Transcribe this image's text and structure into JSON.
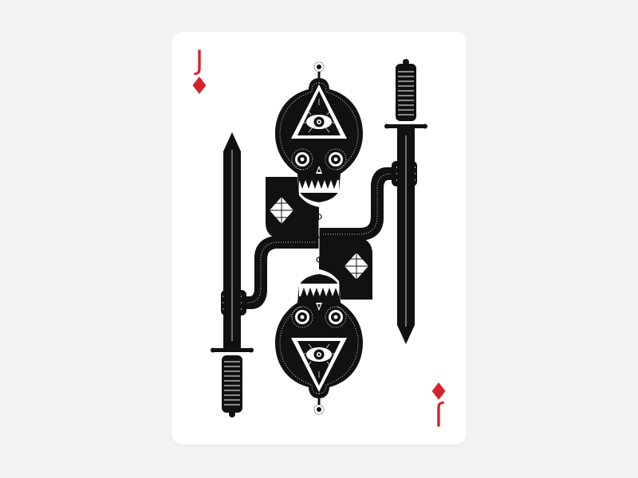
{
  "card": {
    "rank": "J",
    "suit_symbol": "♦",
    "suit_icon": "diamond-icon",
    "ink_color": "#111111",
    "suit_color": "#d6232a",
    "background_color": "#f2f2f2",
    "card_color": "#ffffff"
  }
}
